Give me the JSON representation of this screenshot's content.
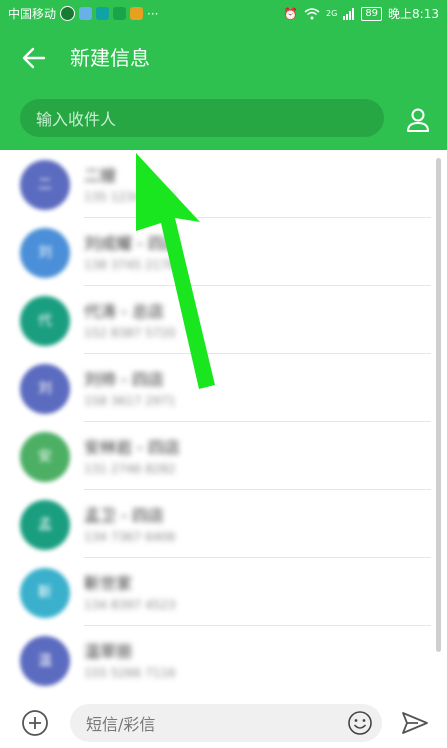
{
  "status_bar": {
    "carrier": "中国移动",
    "app_icons": [
      "green-app-icon",
      "photo-app-icon",
      "cyan-app-icon",
      "play-app-icon",
      "maps-app-icon"
    ],
    "more": "···",
    "network": "2G",
    "battery": "89",
    "time": "晚上8:13"
  },
  "header": {
    "title": "新建信息",
    "recipient_placeholder": "输入收件人"
  },
  "contacts": [
    {
      "initial": "二",
      "name": "二嫂",
      "phone": "135 1234 5604",
      "color": "#5b6bbf"
    },
    {
      "initial": "刘",
      "name": "刘成耀 - 四店",
      "phone": "138 3745 2178",
      "color": "#4a8fd8"
    },
    {
      "initial": "代",
      "name": "代涛 - 总店",
      "phone": "152 8387 5720",
      "color": "#1a9e80"
    },
    {
      "initial": "刘",
      "name": "刘帅 - 四店",
      "phone": "158 3617 2971",
      "color": "#5b6bbf"
    },
    {
      "initial": "安",
      "name": "安林岩 - 四店",
      "phone": "131 2746 8282",
      "color": "#4caf64"
    },
    {
      "initial": "孟",
      "name": "孟卫 - 四店",
      "phone": "134 7367 6406",
      "color": "#1a9e80"
    },
    {
      "initial": "靳",
      "name": "靳世家",
      "phone": "134 8397 4523",
      "color": "#3ab0cc"
    },
    {
      "initial": "温",
      "name": "温翠丽",
      "phone": "155 5266 7116",
      "color": "#5b6bbf"
    }
  ],
  "composer": {
    "placeholder": "短信/彩信"
  },
  "colors": {
    "accent": "#2ec14f",
    "arrow": "#19e61f"
  },
  "icons": {
    "back": "back-arrow-icon",
    "contacts": "person-icon",
    "add": "plus-circle-icon",
    "emoji": "smiley-icon",
    "send": "send-icon"
  }
}
